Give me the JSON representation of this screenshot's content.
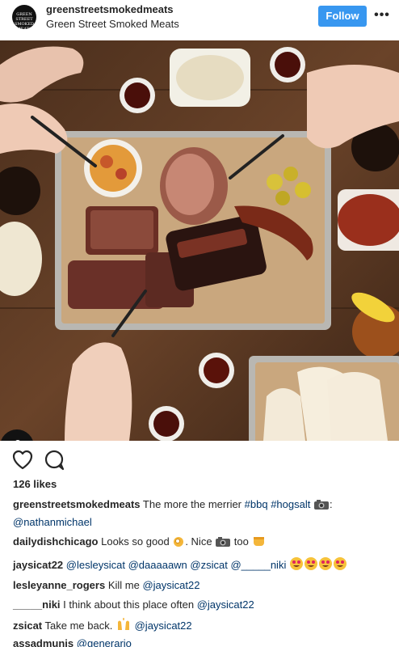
{
  "header": {
    "avatar_text": "GREEN STREET SMOKED MEATS",
    "username": "greenstreetsmokedmeats",
    "location": "Green Street Smoked Meats",
    "follow_label": "Follow",
    "more_label": "•••"
  },
  "post": {
    "likes": "126 likes"
  },
  "icons": {
    "like": "heart-icon",
    "comment": "comment-bubble-icon",
    "tag": "person-tag-icon",
    "camera": "camera-icon"
  },
  "comments": [
    {
      "user": "greenstreetsmokedmeats",
      "text": "The more the merrier",
      "tags": [
        "#bbq",
        "#hogsalt"
      ],
      "suffix": ":",
      "line2": "@nathanmichael"
    },
    {
      "user": "dailydishchicago",
      "text_a": "Looks so good",
      "text_b": ". Nice",
      "text_c": "too"
    },
    {
      "user": "jaysicat22",
      "mentions": [
        "@lesleysicat",
        "@daaaaawn",
        "@zsicat",
        "@_____niki"
      ]
    },
    {
      "user": "lesleyanne_rogers",
      "text": "Kill me",
      "mention": "@jaysicat22"
    },
    {
      "user": "_____niki",
      "text": "I think about this place often",
      "mention": "@jaysicat22"
    },
    {
      "user": "zsicat",
      "text": "Take me back.",
      "mention": "@jaysicat22"
    },
    {
      "user": "assadmunis",
      "mention": "@generario"
    }
  ],
  "colors": {
    "follow_bg": "#3897f0",
    "link": "#003569",
    "text": "#262626"
  }
}
